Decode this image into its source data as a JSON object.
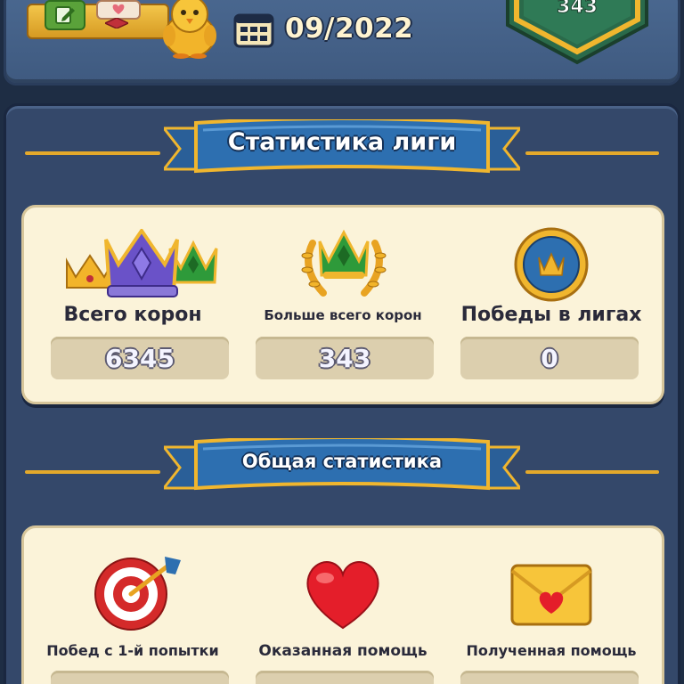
{
  "header": {
    "date": "09/2022",
    "shield_value": "343",
    "icons": [
      "note-edit-icon",
      "heart-card-icon",
      "ruby-icon",
      "golden-chick-icon",
      "calendar-icon",
      "league-shield-icon"
    ]
  },
  "league_stats": {
    "title": "Статистика лиги",
    "items": [
      {
        "label": "Всего корон",
        "value": "6345",
        "icon": "crowns-icon"
      },
      {
        "label": "Больше всего корон",
        "value": "343",
        "icon": "laurel-crown-icon"
      },
      {
        "label": "Победы в лигах",
        "value": "0",
        "icon": "crown-medal-icon"
      }
    ]
  },
  "general_stats": {
    "title": "Общая статистика",
    "items": [
      {
        "label": "Побед с 1-й попытки",
        "value": "",
        "icon": "target-icon"
      },
      {
        "label": "Оказанная помощь",
        "value": "",
        "icon": "heart-icon"
      },
      {
        "label": "Полученная помощь",
        "value": "",
        "icon": "envelope-heart-icon"
      }
    ]
  },
  "colors": {
    "background": "#1e2d44",
    "panel": "#34486a",
    "ribbon": "#2d6fb0",
    "ribbon_trim": "#f0b62e",
    "card": "#fbf3d9",
    "value_box": "#dccfae"
  }
}
